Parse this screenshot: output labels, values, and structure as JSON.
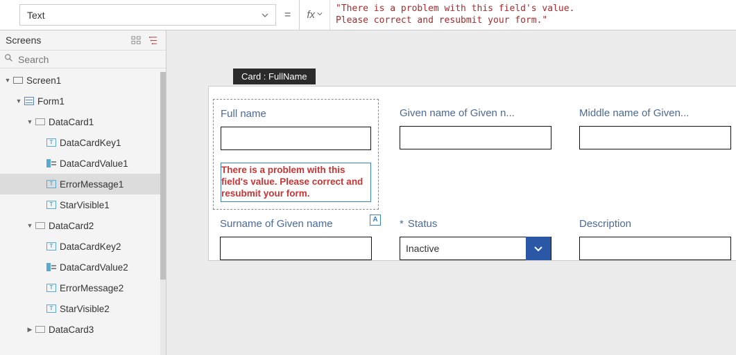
{
  "formula_bar": {
    "property": "Text",
    "equals": "=",
    "fx": "fx",
    "value": "\"There is a problem with this field's value.\nPlease correct and resubmit your form.\""
  },
  "sidebar": {
    "title": "Screens",
    "search_placeholder": "Search",
    "tree": {
      "screen1": "Screen1",
      "form1": "Form1",
      "dc1": "DataCard1",
      "dck1": "DataCardKey1",
      "dcv1": "DataCardValue1",
      "em1": "ErrorMessage1",
      "sv1": "StarVisible1",
      "dc2": "DataCard2",
      "dck2": "DataCardKey2",
      "dcv2": "DataCardValue2",
      "em2": "ErrorMessage2",
      "sv2": "StarVisible2",
      "dc3": "DataCard3"
    }
  },
  "canvas": {
    "selection_tag": "Card : FullName",
    "a_badge": "A",
    "fields": {
      "full_name": {
        "label": "Full name",
        "error": "There is a problem with this field's value.  Please correct and resubmit your form."
      },
      "given_name": {
        "label": "Given name of Given n..."
      },
      "middle_name": {
        "label": "Middle name of Given..."
      },
      "surname": {
        "label": "Surname of Given name"
      },
      "status": {
        "label": "Status",
        "required": "*",
        "value": "Inactive"
      },
      "description": {
        "label": "Description"
      }
    }
  }
}
